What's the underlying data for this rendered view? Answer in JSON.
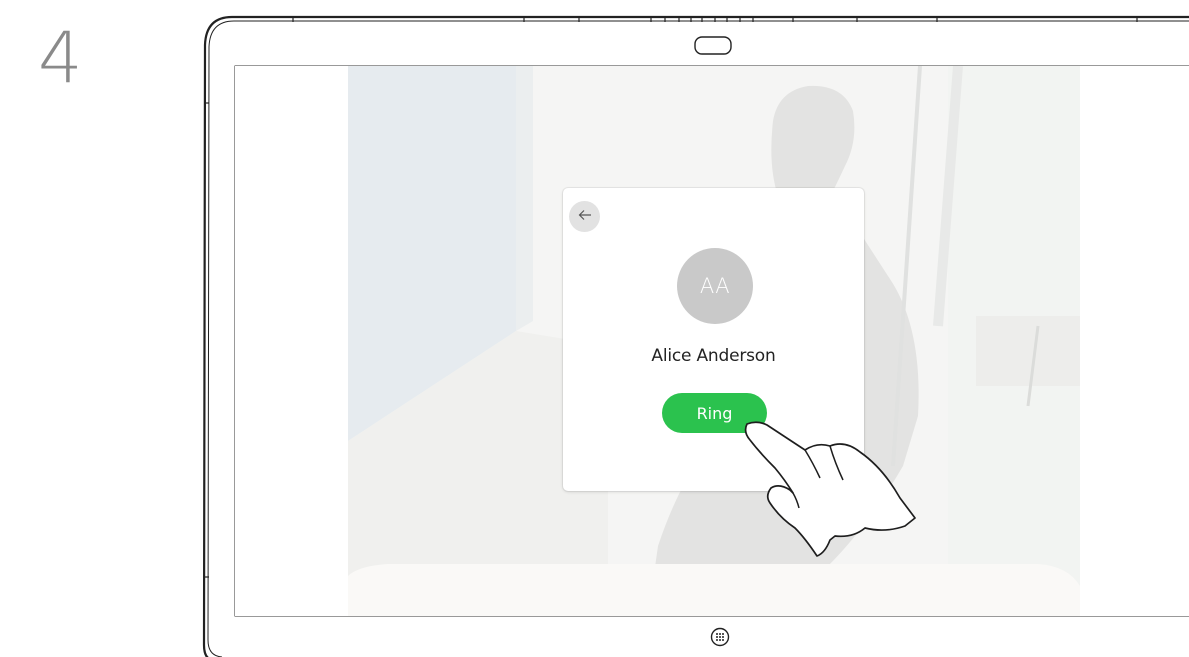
{
  "step": {
    "number": "4"
  },
  "contact_card": {
    "back_icon": "arrow-left-icon",
    "avatar_initials": "AA",
    "name": "Alice Anderson",
    "ring_label": "Ring"
  },
  "device": {
    "home_icon": "keypad-grid-icon",
    "camera_icon": "camera-slot-icon"
  },
  "colors": {
    "ring_button": "#2bc24e",
    "avatar": "#c9c9c9",
    "back_button": "#e2e2e2",
    "step_number": "#8a8a8a",
    "device_outline": "#222222"
  }
}
